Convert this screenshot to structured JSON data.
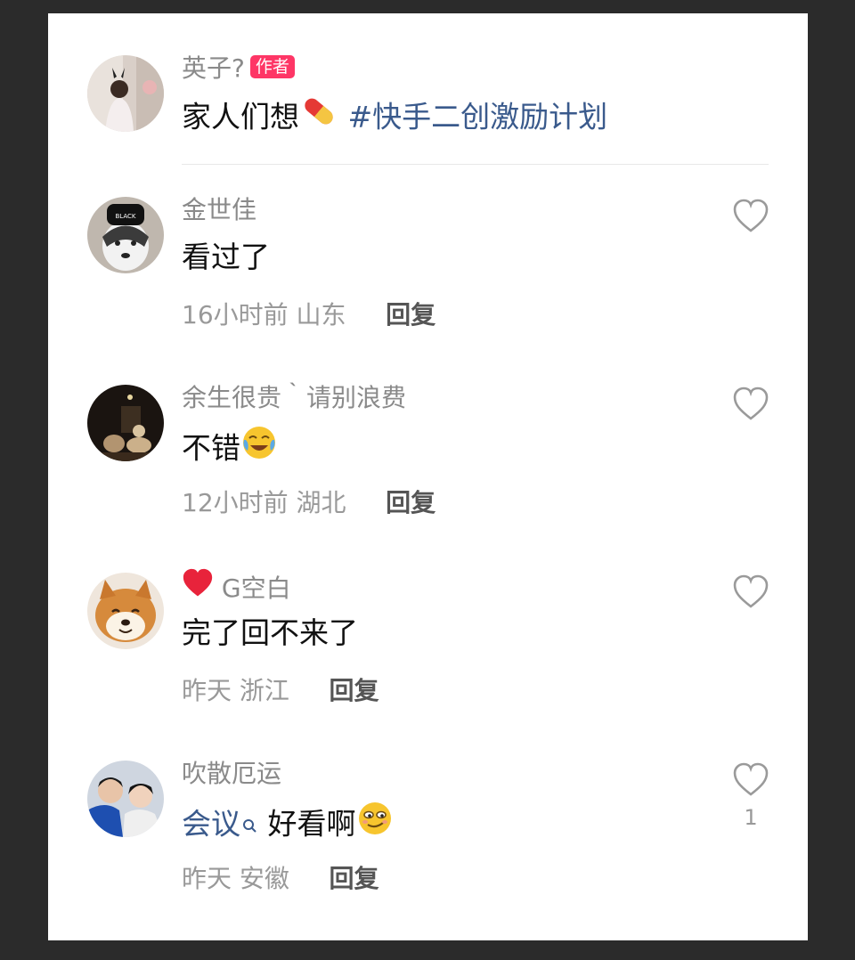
{
  "author_comment": {
    "name": "英子?",
    "badge": "作者",
    "text": "家人们想",
    "emoji": "pill-emoji",
    "hashtag": "#快手二创激励计划"
  },
  "comments": [
    {
      "name": "金世佳",
      "text": "看过了",
      "time": "16小时前",
      "location": "山东",
      "reply_label": "回复",
      "avatar": "husky-avatar"
    },
    {
      "name": "余生很贵｀请别浪费",
      "text": "不错",
      "text_emoji": "crying-laughing-emoji",
      "time": "12小时前",
      "location": "湖北",
      "reply_label": "回复",
      "avatar": "dark-scene-avatar"
    },
    {
      "name_prefix_icon": "red-heart-emoji",
      "name": "G空白",
      "text": "完了回不来了",
      "time": "昨天",
      "location": "浙江",
      "reply_label": "回复",
      "avatar": "shiba-avatar"
    },
    {
      "name": "吹散厄运",
      "link_text": "会议",
      "text": "好看啊",
      "text_emoji": "smirk-emoji",
      "time": "昨天",
      "location": "安徽",
      "reply_label": "回复",
      "like_count": "1",
      "avatar": "couple-avatar"
    }
  ],
  "colors": {
    "background": "#2b2b2b",
    "card": "#ffffff",
    "badge": "#fe3666",
    "hashtag": "#3a5a8c",
    "meta": "#999999"
  }
}
